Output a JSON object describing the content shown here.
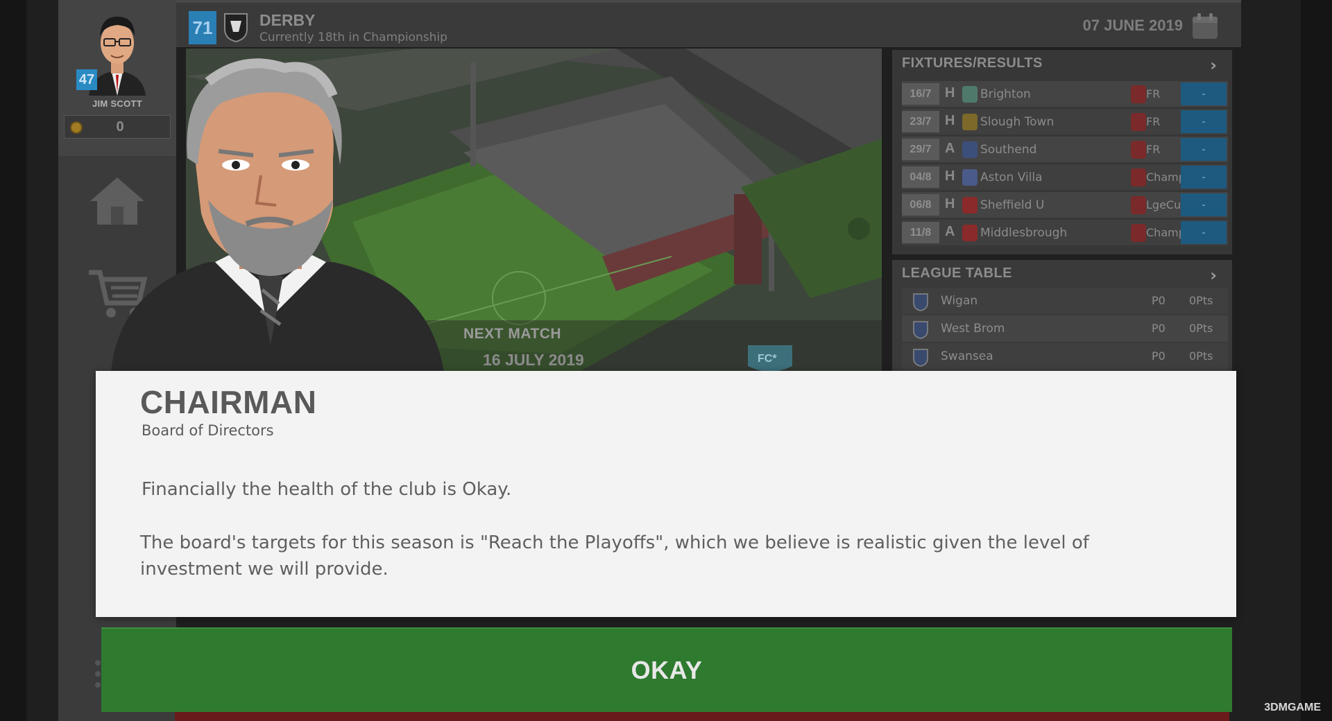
{
  "manager": {
    "name": "JIM SCOTT",
    "rating": "47",
    "coins": "0"
  },
  "club": {
    "rating": "71",
    "name": "DERBY",
    "status": "Currently 18th in Championship"
  },
  "date": "07 JUNE 2019",
  "next_match": {
    "label": "NEXT MATCH",
    "date": "16 JULY 2019"
  },
  "fixtures": {
    "title": "FIXTURES/RESULTS",
    "rows": [
      {
        "date": "16/7",
        "venue": "H",
        "team": "Brighton",
        "comp": "FR",
        "result": "-",
        "team_color": "#4f7a6b"
      },
      {
        "date": "23/7",
        "venue": "H",
        "team": "Slough Town",
        "comp": "FR",
        "result": "-",
        "team_color": "#7d6a2a"
      },
      {
        "date": "29/7",
        "venue": "A",
        "team": "Southend",
        "comp": "FR",
        "result": "-",
        "team_color": "#3b4f7a"
      },
      {
        "date": "04/8",
        "venue": "H",
        "team": "Aston Villa",
        "comp": "Champ",
        "result": "-",
        "team_color": "#4a5a8a"
      },
      {
        "date": "06/8",
        "venue": "H",
        "team": "Sheffield U",
        "comp": "LgeCup",
        "result": "-",
        "team_color": "#8a2a2a"
      },
      {
        "date": "11/8",
        "venue": "A",
        "team": "Middlesbrough",
        "comp": "Champ",
        "result": "-",
        "team_color": "#8a2a2a"
      }
    ]
  },
  "league_table": {
    "title": "LEAGUE TABLE",
    "rows": [
      {
        "team": "Wigan",
        "played": "P0",
        "points": "0Pts"
      },
      {
        "team": "West Brom",
        "played": "P0",
        "points": "0Pts"
      },
      {
        "team": "Swansea",
        "played": "P0",
        "points": "0Pts"
      }
    ]
  },
  "dialog": {
    "title": "CHAIRMAN",
    "subtitle": "Board of Directors",
    "message_1": "Financially the health of the club is Okay.",
    "message_2": "The board's targets for this season is \"Reach the Playoffs\", which we believe is realistic given the level of investment we will provide.",
    "button_label": "OKAY"
  },
  "watermark": "3DMGAME",
  "icons": {
    "home": "home-icon",
    "shop": "shopping-cart-icon",
    "calendar": "calendar-icon",
    "coin": "coin-icon"
  },
  "colors": {
    "club_blue": "#2a7fb5",
    "okay_green": "#2e7a2f",
    "result_blue": "#1e5a80"
  }
}
